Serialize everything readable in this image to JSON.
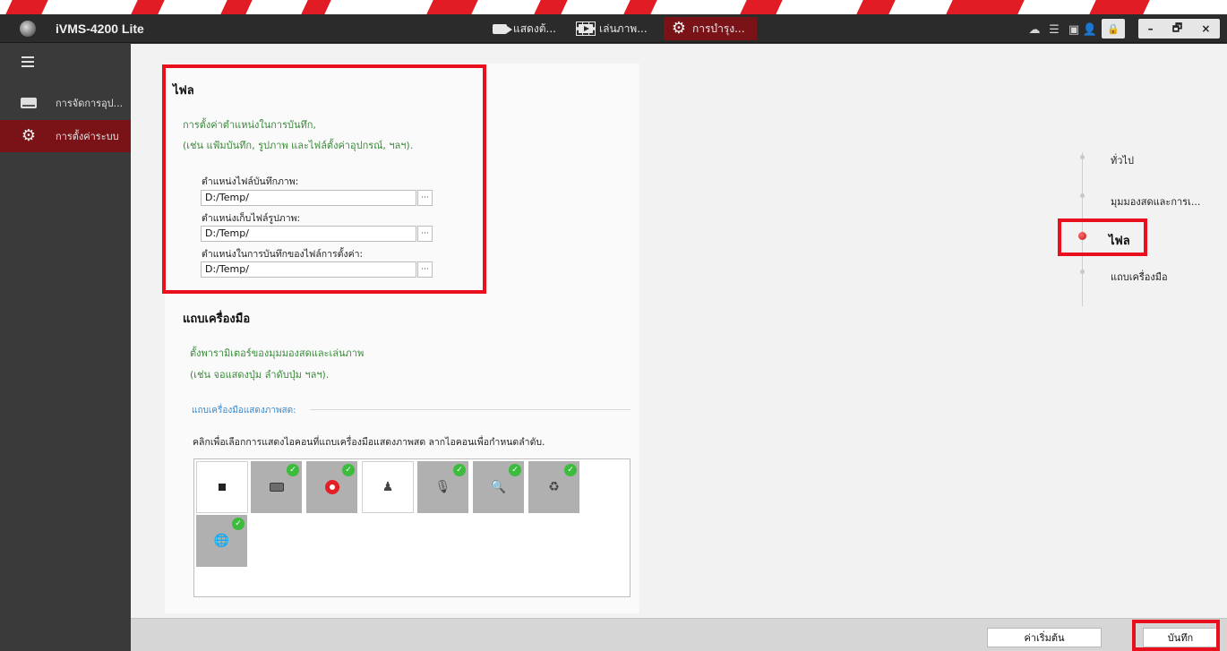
{
  "app": {
    "title": "iVMS-4200 Lite"
  },
  "top_tabs": [
    {
      "label": "แสดงต้...",
      "icon": "camera-icon"
    },
    {
      "label": "เล่นภาพ...",
      "icon": "film-play-icon"
    },
    {
      "label": "การบำรุง...",
      "icon": "gear-icon",
      "active": true
    }
  ],
  "window_controls": {
    "minimize": "–",
    "restore": "🗗",
    "close": "×"
  },
  "sidebar": {
    "items": [
      {
        "label": "การจัดการอุป...",
        "icon": "hard-drive-icon"
      },
      {
        "label": "การตั้งค่าระบบ",
        "icon": "gear-icon",
        "active": true
      }
    ]
  },
  "file_section": {
    "title": "ไฟล",
    "desc_line1": "การตั้งค่าตำแหน่งในการบันทึก,",
    "desc_line2": "(เช่น แฟ้มบันทึก, รูปภาพ และไฟล์ตั้งค่าอุปกรณ์, ฯลฯ).",
    "fields": [
      {
        "label": "ตำแหน่งไฟล์บันทึกภาพ:",
        "value": "D:/Temp/",
        "browse": "···"
      },
      {
        "label": "ตำแหน่งเก็บไฟล์รูปภาพ:",
        "value": "D:/Temp/",
        "browse": "···"
      },
      {
        "label": "ตำแหน่งในการบันทึกของไฟล์การตั้งค่า:",
        "value": "D:/Temp/",
        "browse": "···"
      }
    ]
  },
  "toolbar_section": {
    "title": "แถบเครื่องมือ",
    "desc_line1": "ตั้งพารามิเตอร์ของมุมมองสดและเล่นภาพ",
    "desc_line2": "(เช่น จอแสดงปุ่ม ลำดับปุ่ม ฯลฯ).",
    "subhead": "แถบเครื่องมือแสดงภาพสด:",
    "hint": "คลิกเพื่อเลือกการแสดงไอคอนที่แถบเครื่องมือแสดงภาพสด ลากไอคอนเพื่อกำหนดลำดับ.",
    "tools": [
      {
        "icon": "stop-icon",
        "enabled": false
      },
      {
        "icon": "snapshot-icon",
        "enabled": true
      },
      {
        "icon": "record-icon",
        "enabled": true
      },
      {
        "icon": "person-icon",
        "enabled": false
      },
      {
        "icon": "microphone-icon",
        "enabled": true
      },
      {
        "icon": "zoom-icon",
        "enabled": true
      },
      {
        "icon": "ptz-icon",
        "enabled": true
      },
      {
        "icon": "globe-settings-icon",
        "enabled": true
      }
    ],
    "check_mark": "✓"
  },
  "right_nav": {
    "items": [
      {
        "label": "ทั่วไป"
      },
      {
        "label": "มุมมองสดและการเ..."
      },
      {
        "label": "ไฟล",
        "active": true
      },
      {
        "label": "แถบเครื่องมือ"
      }
    ]
  },
  "footer": {
    "default_label": "ค่าเริ่มต้น",
    "save_label": "บันทึก"
  },
  "colors": {
    "accent": "#7a1318",
    "brand_red": "#e11c24",
    "highlight": "#e8101c",
    "desc_green": "#3a8a3a",
    "check_green": "#3dbb3d"
  }
}
